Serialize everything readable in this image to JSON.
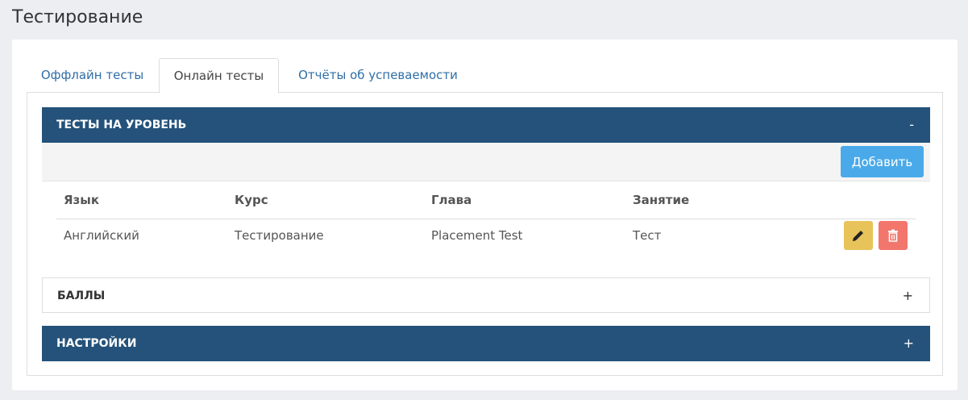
{
  "page": {
    "title": "Тестирование"
  },
  "tabs": [
    {
      "label": "Оффлайн тесты",
      "active": false
    },
    {
      "label": "Онлайн тесты",
      "active": true
    },
    {
      "label": "Отчёты об успеваемости",
      "active": false
    }
  ],
  "panels": {
    "level_tests": {
      "title": "ТЕСТЫ НА УРОВЕНЬ",
      "toggle": "-",
      "add_label": "Добавить",
      "columns": [
        "Язык",
        "Курс",
        "Глава",
        "Занятие"
      ],
      "rows": [
        {
          "language": "Английский",
          "course": "Тестирование",
          "chapter": "Placement Test",
          "lesson": "Тест"
        }
      ]
    },
    "scores": {
      "title": "БАЛЛЫ",
      "toggle": "+"
    },
    "settings": {
      "title": "НАСТРОЙКИ",
      "toggle": "+"
    }
  },
  "icons": {
    "edit": "pencil-icon",
    "delete": "trash-icon"
  },
  "colors": {
    "panel_header": "#24527a",
    "add_button": "#4aaae9",
    "edit_button": "#e8c35a",
    "delete_button": "#f2766c",
    "tab_link": "#2f6ea8"
  }
}
